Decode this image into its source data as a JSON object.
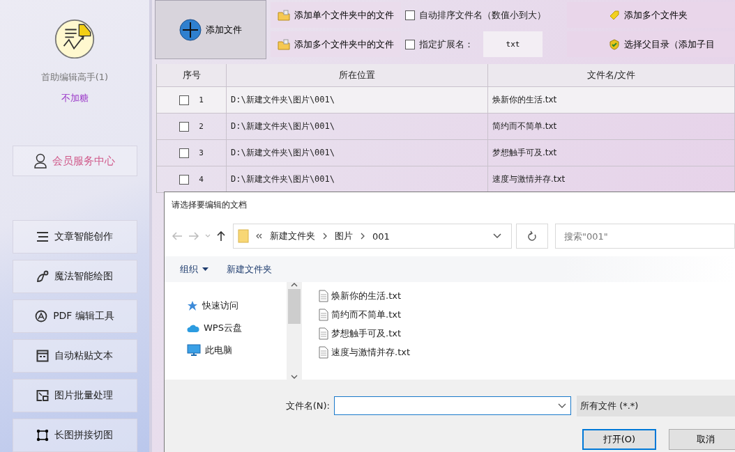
{
  "sidebar": {
    "app_name": "首助编辑高手(1)",
    "user_name": "不加糖",
    "member_button": "会员服务中心",
    "tools": [
      {
        "label": "文章智能创作"
      },
      {
        "label": "魔法智能绘图"
      },
      {
        "label": "PDF 编辑工具"
      },
      {
        "label": "自动粘贴文本"
      },
      {
        "label": "图片批量处理"
      },
      {
        "label": "长图拼接切图"
      }
    ]
  },
  "toolbar": {
    "add_file": "添加文件",
    "folder_buttons": [
      "添加单个文件夹中的文件",
      "添加多个文件夹中的文件"
    ],
    "options": [
      {
        "label": "自动排序文件名（数值小到大）",
        "checked": false
      },
      {
        "label": "指定扩展名：",
        "checked": false
      }
    ],
    "extension": "txt",
    "right_buttons": [
      "添加多个文件夹",
      "选择父目录（添加子目"
    ]
  },
  "table": {
    "columns": [
      "序号",
      "所在位置",
      "文件名/文件"
    ],
    "rows": [
      {
        "checked": false,
        "index": "1",
        "location": "D:\\新建文件夹\\图片\\001\\",
        "name": "焕新你的生活.txt"
      },
      {
        "checked": false,
        "index": "2",
        "location": "D:\\新建文件夹\\图片\\001\\",
        "name": "简约而不简单.txt"
      },
      {
        "checked": false,
        "index": "3",
        "location": "D:\\新建文件夹\\图片\\001\\",
        "name": "梦想触手可及.txt"
      },
      {
        "checked": false,
        "index": "4",
        "location": "D:\\新建文件夹\\图片\\001\\",
        "name": "速度与激情并存.txt"
      }
    ]
  },
  "dialog": {
    "title": "请选择要编辑的文档",
    "path": [
      "新建文件夹",
      "图片",
      "001"
    ],
    "search_placeholder": "搜索\"001\"",
    "organize": "组织",
    "new_folder": "新建文件夹",
    "nav_items": [
      "快速访问",
      "WPS云盘",
      "此电脑"
    ],
    "files": [
      "焕新你的生活.txt",
      "简约而不简单.txt",
      "梦想触手可及.txt",
      "速度与激情并存.txt"
    ],
    "filename_label": "文件名(N):",
    "file_type": "所有文件 (*.*)",
    "buttons": [
      "打开(O)",
      "取消"
    ]
  }
}
